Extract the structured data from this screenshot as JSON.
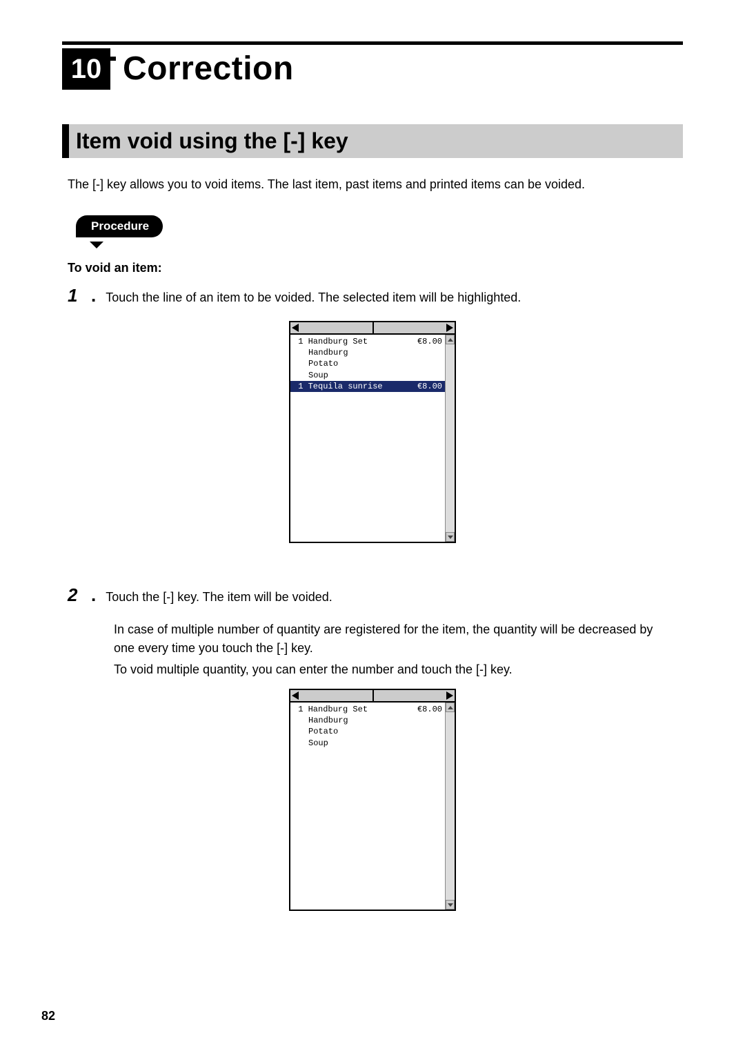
{
  "chapter": {
    "number": "10",
    "title": "Correction"
  },
  "section": {
    "title": "Item void using the [-] key"
  },
  "intro": "The [-] key allows you to void items.  The last item, past items and printed items can be voided.",
  "procedure_label": "Procedure",
  "void_label": "To void an item:",
  "step1": {
    "num": "1",
    "text": "Touch the line of an item to be voided.  The selected item will be highlighted."
  },
  "step2": {
    "num": "2",
    "text": "Touch the [-] key.  The item will be voided.",
    "sub1": "In case of multiple number of quantity are registered for the item, the quantity will be decreased by one every time you touch the [-] key.",
    "sub2": "To void multiple quantity, you can enter the number and touch the [-] key."
  },
  "screen1": {
    "rows": [
      {
        "qty": "1",
        "name": "Handburg Set",
        "price": "€8.00",
        "bold": true
      },
      {
        "qty": "",
        "name": "Handburg",
        "price": "",
        "indent": true
      },
      {
        "qty": "",
        "name": "Potato",
        "price": "",
        "indent": true
      },
      {
        "qty": "",
        "name": "Soup",
        "price": "",
        "indent": true
      },
      {
        "qty": "1",
        "name": "Tequila sunrise",
        "price": "€8.00",
        "selected": true
      }
    ]
  },
  "screen2": {
    "rows": [
      {
        "qty": "1",
        "name": "Handburg Set",
        "price": "€8.00",
        "bold": true
      },
      {
        "qty": "",
        "name": "Handburg",
        "price": "",
        "indent": true
      },
      {
        "qty": "",
        "name": "Potato",
        "price": "",
        "indent": true
      },
      {
        "qty": "",
        "name": "Soup",
        "price": "",
        "indent": true
      }
    ]
  },
  "page_number": "82"
}
